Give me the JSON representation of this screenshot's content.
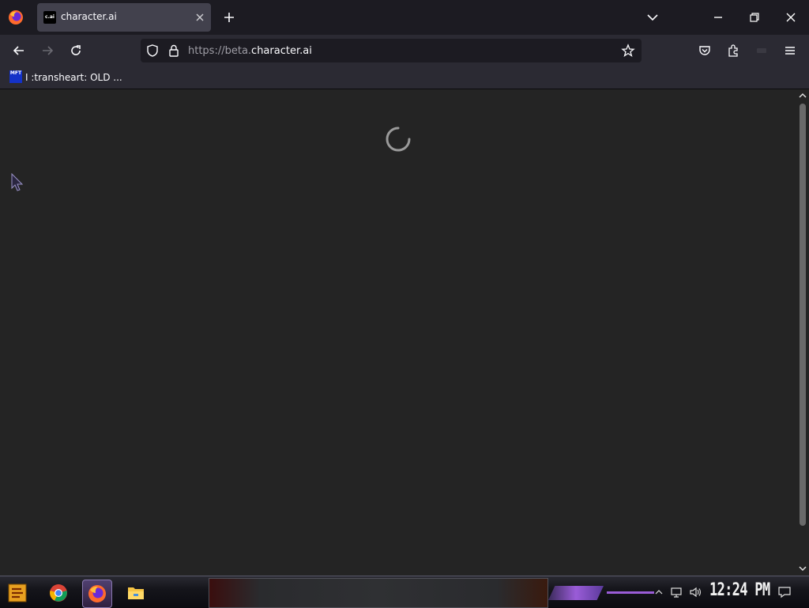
{
  "browser": {
    "tab": {
      "favicon_text": "c.ai",
      "title": "character.ai"
    },
    "url": {
      "prefix": "https://beta.",
      "domain": "character.ai"
    }
  },
  "bookmarks": [
    {
      "icon_text": "MFT",
      "label": "I :transheart: OLD ..."
    }
  ],
  "content": {
    "state": "loading"
  },
  "taskbar": {
    "apps": [
      "start-icon",
      "chrome-icon",
      "firefox-icon",
      "file-explorer-icon"
    ],
    "clock": "12:24 PM"
  },
  "colors": {
    "tab_bg": "#42414d",
    "page_bg": "#242424",
    "accent": "#9a5cd8"
  }
}
